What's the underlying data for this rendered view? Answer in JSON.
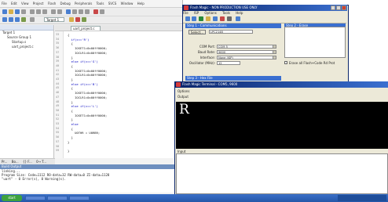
{
  "ide": {
    "menu": [
      "File",
      "Edit",
      "View",
      "Project",
      "Flash",
      "Debug",
      "Peripherals",
      "Tools",
      "SVCS",
      "Window",
      "Help"
    ],
    "target_label": "Target 1",
    "project_items": [
      "Target 1",
      "Source Group 1",
      "Startup.s",
      "uart_project.c"
    ],
    "active_tab": "uart_project.c",
    "line_numbers": [
      "33",
      "34",
      "35",
      "36",
      "37",
      "38",
      "39",
      "40",
      "41",
      "42",
      "43",
      "44",
      "45",
      "46",
      "47",
      "48",
      "49",
      "50",
      "51",
      "52",
      "53",
      "54",
      "55",
      "56",
      "57",
      "58",
      "59"
    ],
    "code_lines": [
      "{",
      "  if(c=='R')",
      "  {",
      "    IOSET1=0x00ff0000;",
      "    IOCLR1=0x00ff0000;",
      "  }",
      "  else if(c=='G')",
      "  {",
      "    IOSET1=0x00ff0000;",
      "    IOCLR1=0x00ff0000;",
      "  }",
      "  else if(c=='B')",
      "  {",
      "    IOSET1=0x00ff0000;",
      "    IOCLR1=0x00ff0000;",
      "  }",
      "  else if(c=='L')",
      "  {",
      "    IOSET1=0x00ff0000;",
      "  }",
      "  else",
      "  {",
      "    U0THR = U0RBR;",
      "  }",
      "}",
      "",
      "}"
    ],
    "bottom_tabs": [
      "Pr...",
      "Bo...",
      "{} F...",
      "0→ T..."
    ],
    "build_title": "Build Output",
    "build_lines": [
      "linking...",
      "Program Size: Code=1112 RO-data=32 RW-data=0 ZI-data=1128",
      "\"uart\" - 0 Error(s), 0 Warning(s)."
    ]
  },
  "flashmagic": {
    "title": "Flash Magic - NON PRODUCTION USE ONLY",
    "menu": [
      "File",
      "ISP",
      "Options",
      "Tools",
      "Help"
    ],
    "step1_title": "Step 1 - Communications",
    "step2_title": "Step 2 - Erase",
    "select_button": "Select...",
    "device_value": "LPC2148",
    "com_port_label": "COM Port:",
    "com_port_value": "COM 5",
    "baud_label": "Baud Rate:",
    "baud_value": "9600",
    "interface_label": "Interface:",
    "interface_value": "None (ISP)",
    "osc_label": "Oscillator (MHz):",
    "osc_value": "12",
    "erase_all_label": "Erase all Flash+Code Rd Prot",
    "step3_title": "Step 3 - Hex File"
  },
  "terminal": {
    "title": "Flash Magic Terminal - COM5, 9600",
    "options_label": "Options",
    "output_label": "Output",
    "received_char": "R",
    "input_label": "Input"
  },
  "taskbar": {
    "start_label": "start"
  }
}
